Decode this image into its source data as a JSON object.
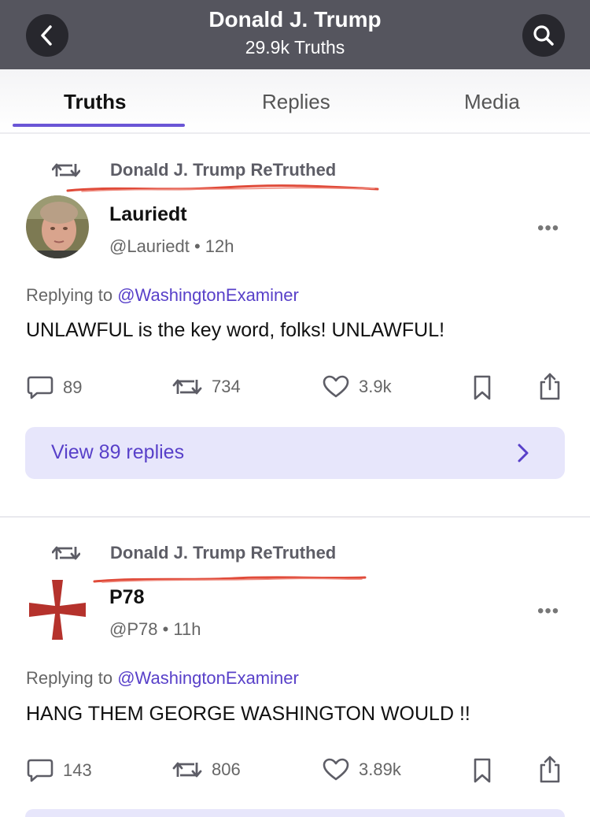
{
  "header": {
    "title": "Donald J. Trump",
    "subtitle": "29.9k Truths",
    "back_icon": "chevron-left-icon",
    "search_icon": "search-icon"
  },
  "tabs": [
    {
      "label": "Truths",
      "active": true
    },
    {
      "label": "Replies",
      "active": false
    },
    {
      "label": "Media",
      "active": false
    }
  ],
  "posts": [
    {
      "retruth_label": "Donald J. Trump ReTruthed",
      "name": "Lauriedt",
      "handle_time": "@Lauriedt • 12h",
      "replying_prefix": "Replying to",
      "replying_mention": "@WashingtonExaminer",
      "text": "UNLAWFUL is the key word, folks! UNLAWFUL!",
      "replies": "89",
      "retruths": "734",
      "likes": "3.9k",
      "view_replies": "View 89 replies"
    },
    {
      "retruth_label": "Donald J. Trump ReTruthed",
      "name": "P78",
      "handle_time": "@P78 • 11h",
      "replying_prefix": "Replying to",
      "replying_mention": "@WashingtonExaminer",
      "text": "HANG THEM GEORGE WASHINGTON WOULD !!",
      "replies": "143",
      "retruths": "806",
      "likes": "3.89k"
    }
  ],
  "more_label": "•••",
  "colors": {
    "header_bg": "#55555e",
    "accent": "#5840c9",
    "tab_underline": "#6a55d6",
    "view_replies_bg": "#e7e6fb",
    "annotation_red": "#e04b3a",
    "cross_red": "#b5322c"
  }
}
